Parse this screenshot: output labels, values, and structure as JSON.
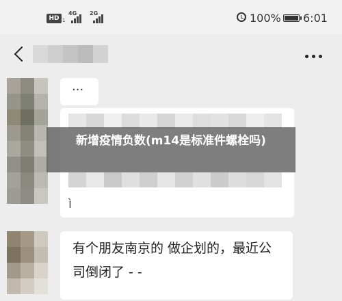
{
  "status_bar": {
    "hd_badge": "HD",
    "hd_sub": "1",
    "network_a": "4G",
    "network_b": "2G",
    "battery_percent": "100%",
    "time": "6:01"
  },
  "header": {
    "back_icon": "chevron-left-icon",
    "more_icon": "more-dots-icon"
  },
  "messages": {
    "first_bubble_text": "...",
    "second_bubble_tail": "ì",
    "third_bubble_text": "有个朋友南京的 做企划的，最近公司倒闭了 - -"
  },
  "caption": {
    "text": "新增疫情负数(m14是标准件螺栓吗)"
  },
  "colors": {
    "background": "#ededed",
    "bubble": "#ffffff",
    "caption_overlay": "#5a5a5a"
  }
}
